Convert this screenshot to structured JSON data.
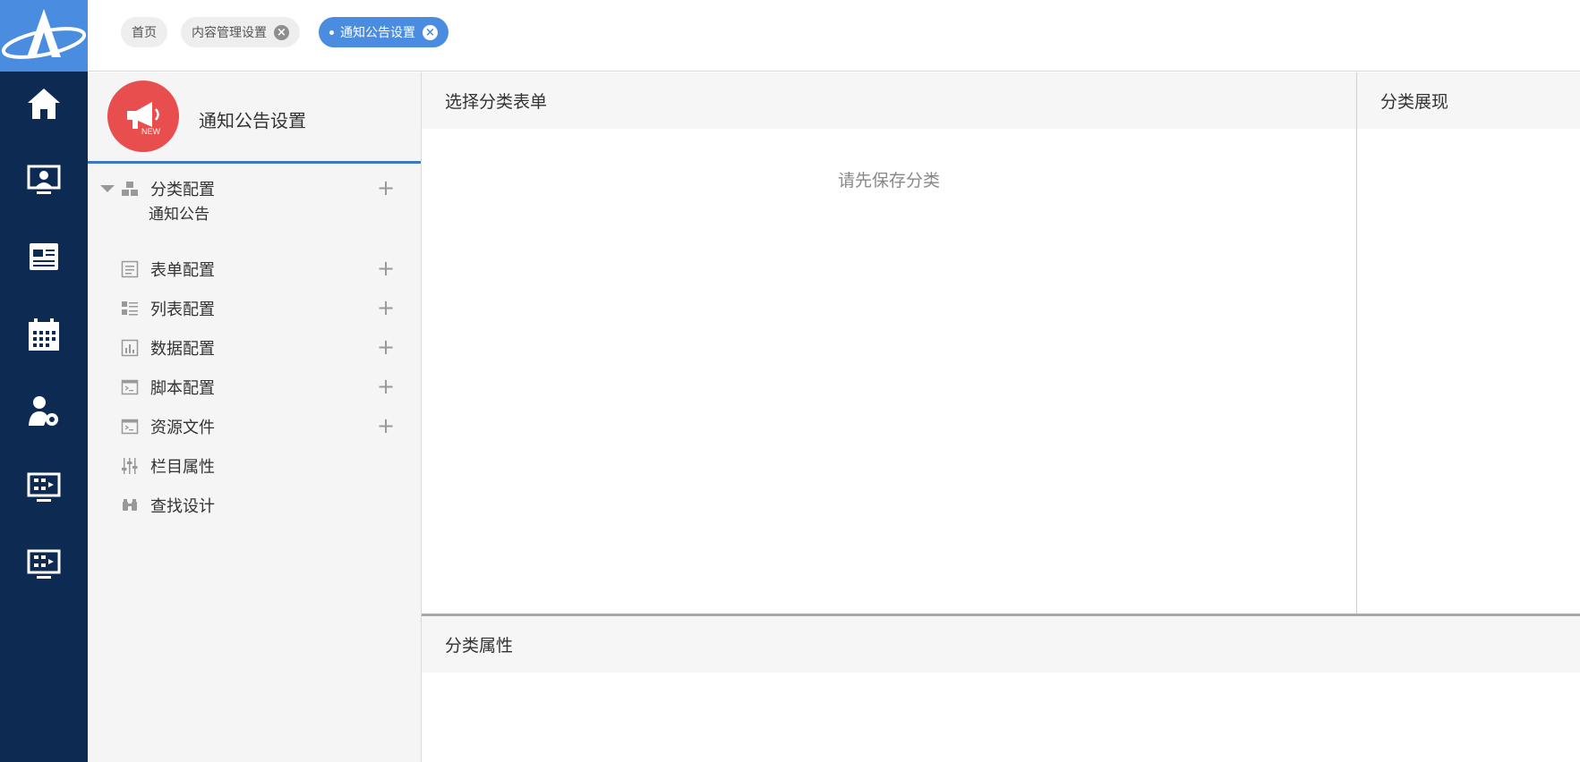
{
  "tabs": [
    {
      "label": "首页",
      "closable": false,
      "active": false
    },
    {
      "label": "内容管理设置",
      "closable": true,
      "active": false
    },
    {
      "label": "通知公告设置",
      "closable": true,
      "active": true
    }
  ],
  "rail": {
    "icons": [
      "home-icon",
      "user-monitor-icon",
      "news-icon",
      "calendar-icon",
      "user-settings-icon",
      "flow-monitor-icon",
      "flow-monitor-icon"
    ]
  },
  "tree": {
    "title": "通知公告设置",
    "badge_text": "NEW",
    "items": [
      {
        "label": "分类配置",
        "icon": "category-icon",
        "expandable": true,
        "plus": true
      },
      {
        "label": "表单配置",
        "icon": "form-icon",
        "plus": true
      },
      {
        "label": "列表配置",
        "icon": "list-icon",
        "plus": true
      },
      {
        "label": "数据配置",
        "icon": "chart-icon",
        "plus": true
      },
      {
        "label": "脚本配置",
        "icon": "script-icon",
        "plus": true
      },
      {
        "label": "资源文件",
        "icon": "script-icon",
        "plus": true
      },
      {
        "label": "栏目属性",
        "icon": "sliders-icon",
        "plus": false
      },
      {
        "label": "查找设计",
        "icon": "binoculars-icon",
        "plus": false
      }
    ],
    "child": "通知公告"
  },
  "panels": {
    "select_form": {
      "title": "选择分类表单",
      "empty": "请先保存分类"
    },
    "display": {
      "title": "分类展现"
    },
    "props": {
      "title": "分类属性"
    }
  },
  "colors": {
    "rail": "#0c2a52",
    "accent": "#4a8de0",
    "badge": "#e84e4e"
  }
}
